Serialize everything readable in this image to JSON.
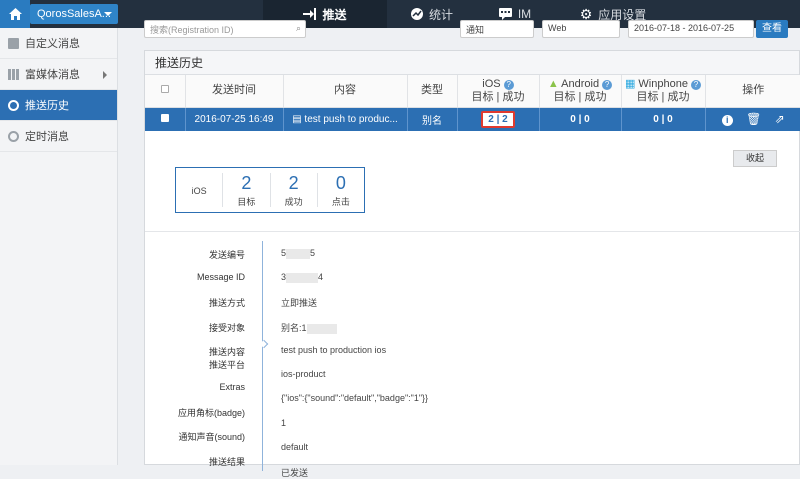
{
  "topbar": {
    "app_name": "QorosSalesA...",
    "nav": [
      {
        "label": "推送",
        "icon": "push-icon"
      },
      {
        "label": "统计",
        "icon": "stats-icon"
      },
      {
        "label": "IM",
        "icon": "chat-icon"
      },
      {
        "label": "应用设置",
        "icon": "gear-icon"
      }
    ]
  },
  "sidebar": {
    "items": [
      {
        "label": "自定义消息"
      },
      {
        "label": "富媒体消息"
      },
      {
        "label": "推送历史"
      },
      {
        "label": "定时消息"
      }
    ]
  },
  "filters": {
    "search_placeholder": "搜索(Registration ID)",
    "type_value": "通知",
    "source_value": "Web",
    "date_range": "2016-07-18 - 2016-07-25",
    "query_label": "查看"
  },
  "panel": {
    "title": "推送历史",
    "columns": {
      "send_time": "发送时间",
      "content": "内容",
      "type": "类型",
      "ios": "iOS",
      "android": "Android",
      "winphone": "Winphone",
      "target_success": "目标 | 成功",
      "actions": "操作"
    },
    "row": {
      "send_time": "2016-07-25 16:49",
      "content": "test push to produc...",
      "type": "别名",
      "ios": "2 | 2",
      "android": "0 | 0",
      "winphone": "0 | 0"
    },
    "collapse_label": "收起"
  },
  "stats": {
    "platform": "iOS",
    "target_value": "2",
    "target_label": "目标",
    "success_value": "2",
    "success_label": "成功",
    "click_value": "0",
    "click_label": "点击"
  },
  "detail": {
    "labels": {
      "send_id": "发送编号",
      "message_id": "Message ID",
      "push_method": "推送方式",
      "recipient": "接受对象",
      "push_content": "推送内容",
      "push_platform": "推送平台",
      "extras": "Extras",
      "badge": "应用角标(badge)",
      "sound": "通知声音(sound)",
      "result": "推送结果"
    },
    "values": {
      "send_id_start": "5",
      "send_id_end": "5",
      "message_id_start": "3",
      "message_id_end": "4",
      "push_method": "立即推送",
      "recipient": "别名:1",
      "push_content": "test push to production ios",
      "push_platform": "ios-product",
      "extras": "{\"ios\":{\"sound\":\"default\",\"badge\":\"1\"}}",
      "badge": "1",
      "sound": "default",
      "result": "已发送"
    }
  },
  "colors": {
    "accent": "#2c6fb3",
    "topbar": "#23303f",
    "highlight_border": "#e03a2f"
  }
}
